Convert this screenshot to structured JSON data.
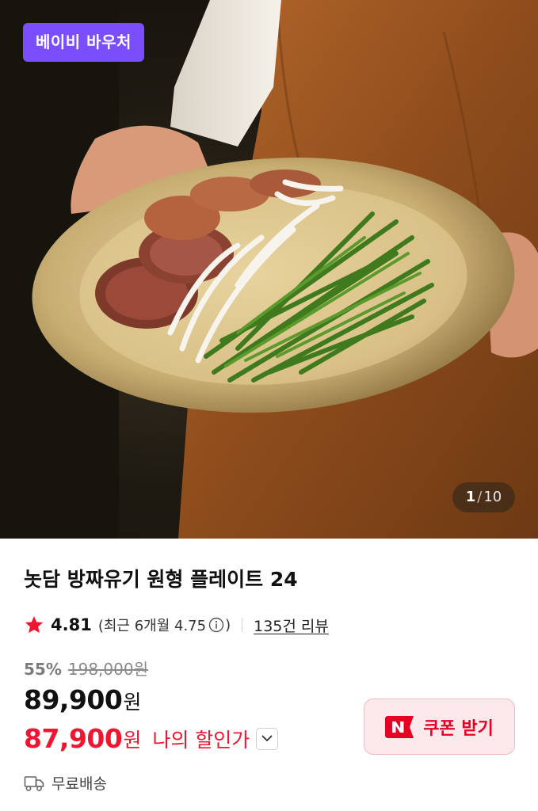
{
  "hero": {
    "badge_label": "베이비 바우처",
    "image_index": "1",
    "image_total": "10",
    "separator": "/"
  },
  "product": {
    "title": "놋담 방짜유기 원형 플레이트 24",
    "rating": "4.81",
    "recent_rating_prefix": "(최근 6개월 4.75",
    "recent_rating_suffix": ")",
    "review_count": "135건 리뷰",
    "discount_rate": "55%",
    "original_price": "198,000원",
    "price": "89,900",
    "price_unit": "원",
    "my_price": "87,900",
    "my_price_unit": "원",
    "my_price_label": "나의 할인가",
    "coupon_label": "쿠폰 받기",
    "shipping_label": "무료배송"
  },
  "icons": {
    "star": "star-icon",
    "info": "info-icon",
    "chevron": "chevron-down-icon",
    "naver": "naver-n-logo",
    "truck": "truck-icon"
  },
  "colors": {
    "badge_bg": "#7a4dfd",
    "star": "#f0162f",
    "sale_red": "#f0162f",
    "coupon_bg": "#fde8ec",
    "coupon_text": "#e60023"
  }
}
